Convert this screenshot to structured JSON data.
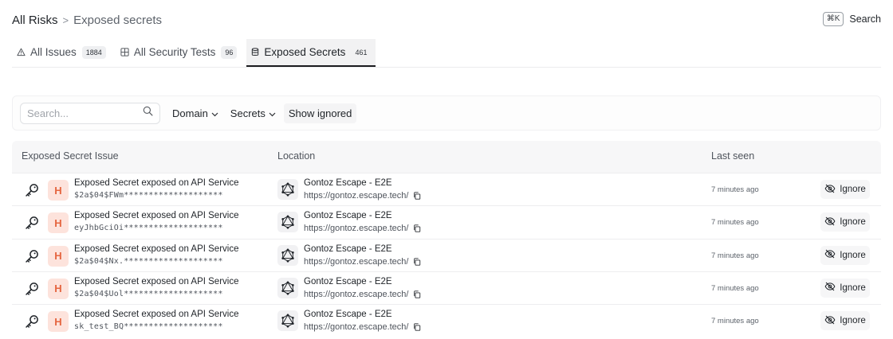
{
  "breadcrumb": {
    "root": "All Risks",
    "separator": ">",
    "current": "Exposed secrets"
  },
  "search_shortcut": {
    "kbd": "⌘K",
    "label": "Search"
  },
  "tabs": [
    {
      "label": "All Issues",
      "count": "1884",
      "icon": "warning-triangle-icon",
      "active": false
    },
    {
      "label": "All Security Tests",
      "count": "96",
      "icon": "grid-icon",
      "active": false
    },
    {
      "label": "Exposed Secrets",
      "count": "461",
      "icon": "database-icon",
      "active": true
    }
  ],
  "filters": {
    "search_placeholder": "Search...",
    "domain_label": "Domain",
    "secrets_label": "Secrets",
    "show_ignored_label": "Show ignored"
  },
  "table": {
    "headers": {
      "issue": "Exposed Secret Issue",
      "location": "Location",
      "last_seen": "Last seen"
    },
    "rows": [
      {
        "severity": "H",
        "title": "Exposed Secret exposed on API Service",
        "secret": "$2a$04$FWm********************",
        "project": "Gontoz Escape - E2E",
        "url": "https://gontoz.escape.tech/",
        "last_seen": "7 minutes ago",
        "action": "Ignore"
      },
      {
        "severity": "H",
        "title": "Exposed Secret exposed on API Service",
        "secret": "eyJhbGciOi********************",
        "project": "Gontoz Escape - E2E",
        "url": "https://gontoz.escape.tech/",
        "last_seen": "7 minutes ago",
        "action": "Ignore"
      },
      {
        "severity": "H",
        "title": "Exposed Secret exposed on API Service",
        "secret": "$2a$04$Nx.********************",
        "project": "Gontoz Escape - E2E",
        "url": "https://gontoz.escape.tech/",
        "last_seen": "7 minutes ago",
        "action": "Ignore"
      },
      {
        "severity": "H",
        "title": "Exposed Secret exposed on API Service",
        "secret": "$2a$04$Uol********************",
        "project": "Gontoz Escape - E2E",
        "url": "https://gontoz.escape.tech/",
        "last_seen": "7 minutes ago",
        "action": "Ignore"
      },
      {
        "severity": "H",
        "title": "Exposed Secret exposed on API Service",
        "secret": "sk_test_BQ********************",
        "project": "Gontoz Escape - E2E",
        "url": "https://gontoz.escape.tech/",
        "last_seen": "7 minutes ago",
        "action": "Ignore"
      }
    ]
  },
  "colors": {
    "severity_high_bg": "#fde3dc",
    "severity_high_text": "#e5653f",
    "active_tab_underline": "#1b1c1f"
  }
}
